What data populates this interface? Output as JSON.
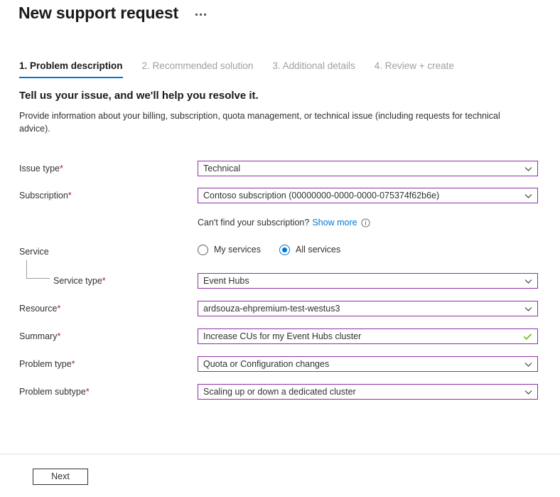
{
  "header": {
    "title": "New support request",
    "more_menu": "ellipsis-menu"
  },
  "tabs": [
    {
      "label": "1. Problem description",
      "active": true
    },
    {
      "label": "2. Recommended solution",
      "active": false
    },
    {
      "label": "3. Additional details",
      "active": false
    },
    {
      "label": "4. Review + create",
      "active": false
    }
  ],
  "intro": {
    "heading": "Tell us your issue, and we'll help you resolve it.",
    "description": "Provide information about your billing, subscription, quota management, or technical issue (including requests for technical advice)."
  },
  "form": {
    "issue_type": {
      "label": "Issue type",
      "required": "*",
      "value": "Technical"
    },
    "subscription": {
      "label": "Subscription",
      "required": "*",
      "value": "Contoso subscription (00000000-0000-0000-075374f62b6e)"
    },
    "subscription_hint": {
      "text": "Can't find your subscription?",
      "link": "Show more",
      "info_icon": "info-circle-icon"
    },
    "service": {
      "label": "Service"
    },
    "service_scope": {
      "options": [
        {
          "label": "My services",
          "selected": false
        },
        {
          "label": "All services",
          "selected": true
        }
      ]
    },
    "service_type": {
      "label": "Service type",
      "required": "*",
      "value": "Event Hubs"
    },
    "resource": {
      "label": "Resource",
      "required": "*",
      "value": "ardsouza-ehpremium-test-westus3"
    },
    "summary": {
      "label": "Summary",
      "required": "*",
      "value": "Increase CUs for my Event Hubs cluster",
      "status_icon": "check-valid-icon"
    },
    "problem_type": {
      "label": "Problem type",
      "required": "*",
      "value": "Quota or Configuration changes"
    },
    "problem_subtype": {
      "label": "Problem subtype",
      "required": "*",
      "value": "Scaling up or down a dedicated cluster"
    }
  },
  "footer": {
    "next_label": "Next"
  },
  "colors": {
    "accent_blue": "#0078d4",
    "field_border_purple": "#8e2fa8",
    "required_red": "#a4262c",
    "valid_green": "#6bb700",
    "tab_inactive": "#a19f9d"
  }
}
